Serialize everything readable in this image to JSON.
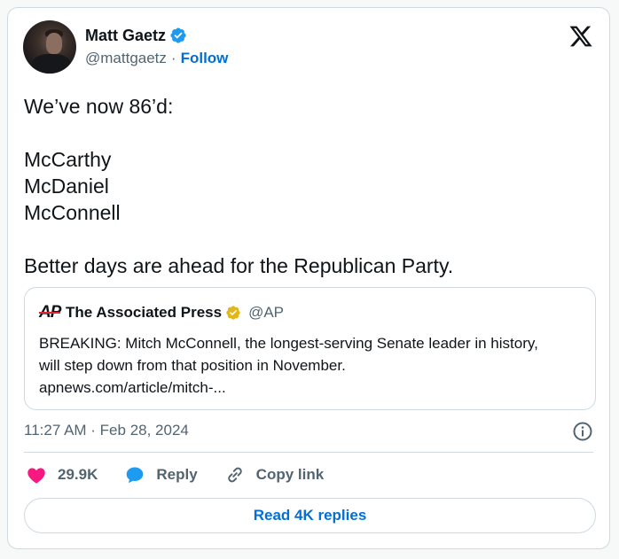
{
  "author": {
    "name": "Matt Gaetz",
    "handle": "@mattgaetz",
    "separator": "·",
    "follow_label": "Follow",
    "avatar_icon": "profile-photo",
    "badge_icon": "verified-blue-badge",
    "badge_color": "#1d9bf0"
  },
  "platform_icon": "x-logo-icon",
  "tweet": {
    "lines": [
      "We’ve now 86’d:",
      "",
      "McCarthy",
      "McDaniel",
      "McConnell",
      "",
      "Better days are ahead for the Republican Party."
    ]
  },
  "quote": {
    "logo_text": "AP",
    "name": "The Associated Press",
    "badge_icon": "verified-gold-badge",
    "badge_color": "#e2b719",
    "handle": "@AP",
    "body_lines": [
      "BREAKING: Mitch McConnell, the longest-serving Senate leader in history,",
      "will step down from that position in November.",
      "apnews.com/article/mitch-..."
    ]
  },
  "meta": {
    "timestamp": "11:27 AM · Feb 28, 2024",
    "info_icon": "info-icon"
  },
  "actions": {
    "like_count": "29.9K",
    "like_icon": "heart-icon",
    "like_color": "#f91880",
    "reply_label": "Reply",
    "reply_icon": "speech-bubble-icon",
    "reply_color": "#1d9bf0",
    "copy_label": "Copy link",
    "copy_icon": "link-icon"
  },
  "replies_button": {
    "label": "Read 4K replies"
  },
  "colors": {
    "link_blue": "#006fd6",
    "muted_text": "#536471",
    "border": "#cfd9de"
  }
}
